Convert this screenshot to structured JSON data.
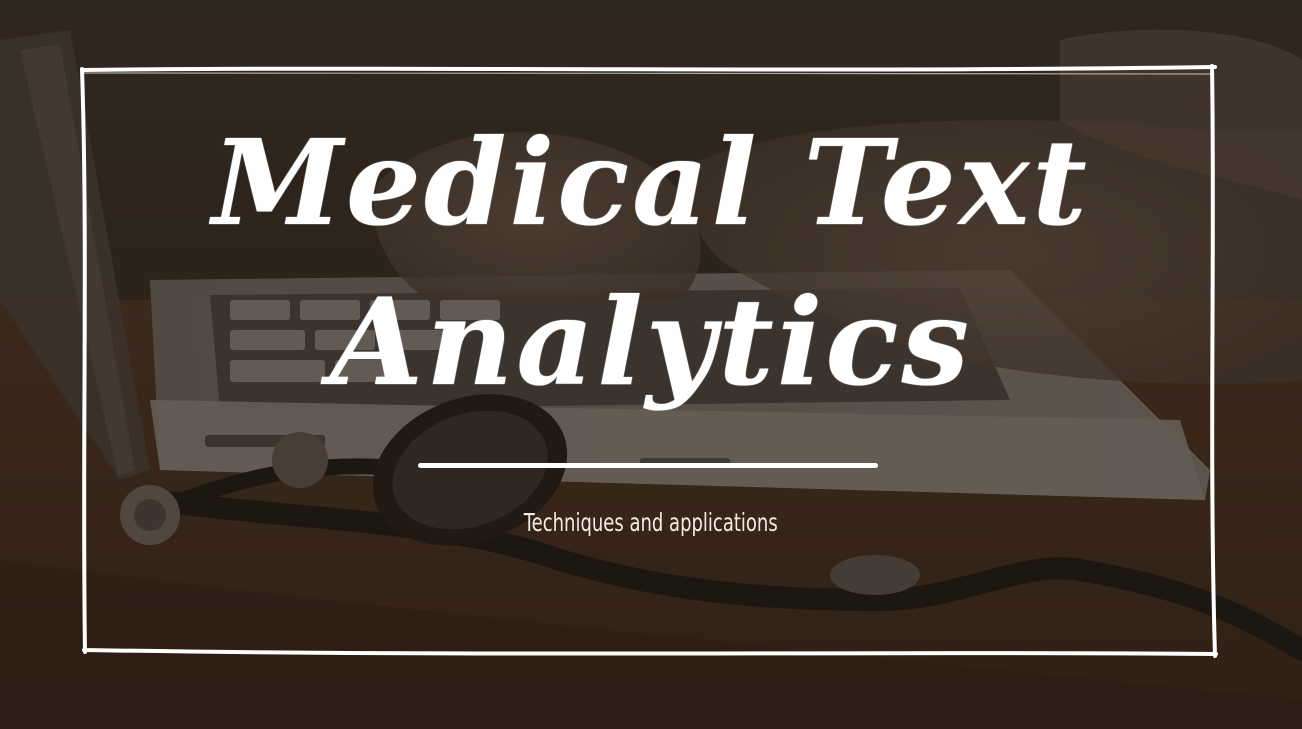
{
  "slide": {
    "title_line_1": "Medical Text",
    "title_line_2": "Analytics",
    "subtitle": "Techniques and applications"
  },
  "colors": {
    "overlay": "#2b221b",
    "text": "#ffffff",
    "frame": "#ffffff"
  },
  "background_image": {
    "subject": "stethoscope-on-laptop-photo"
  }
}
